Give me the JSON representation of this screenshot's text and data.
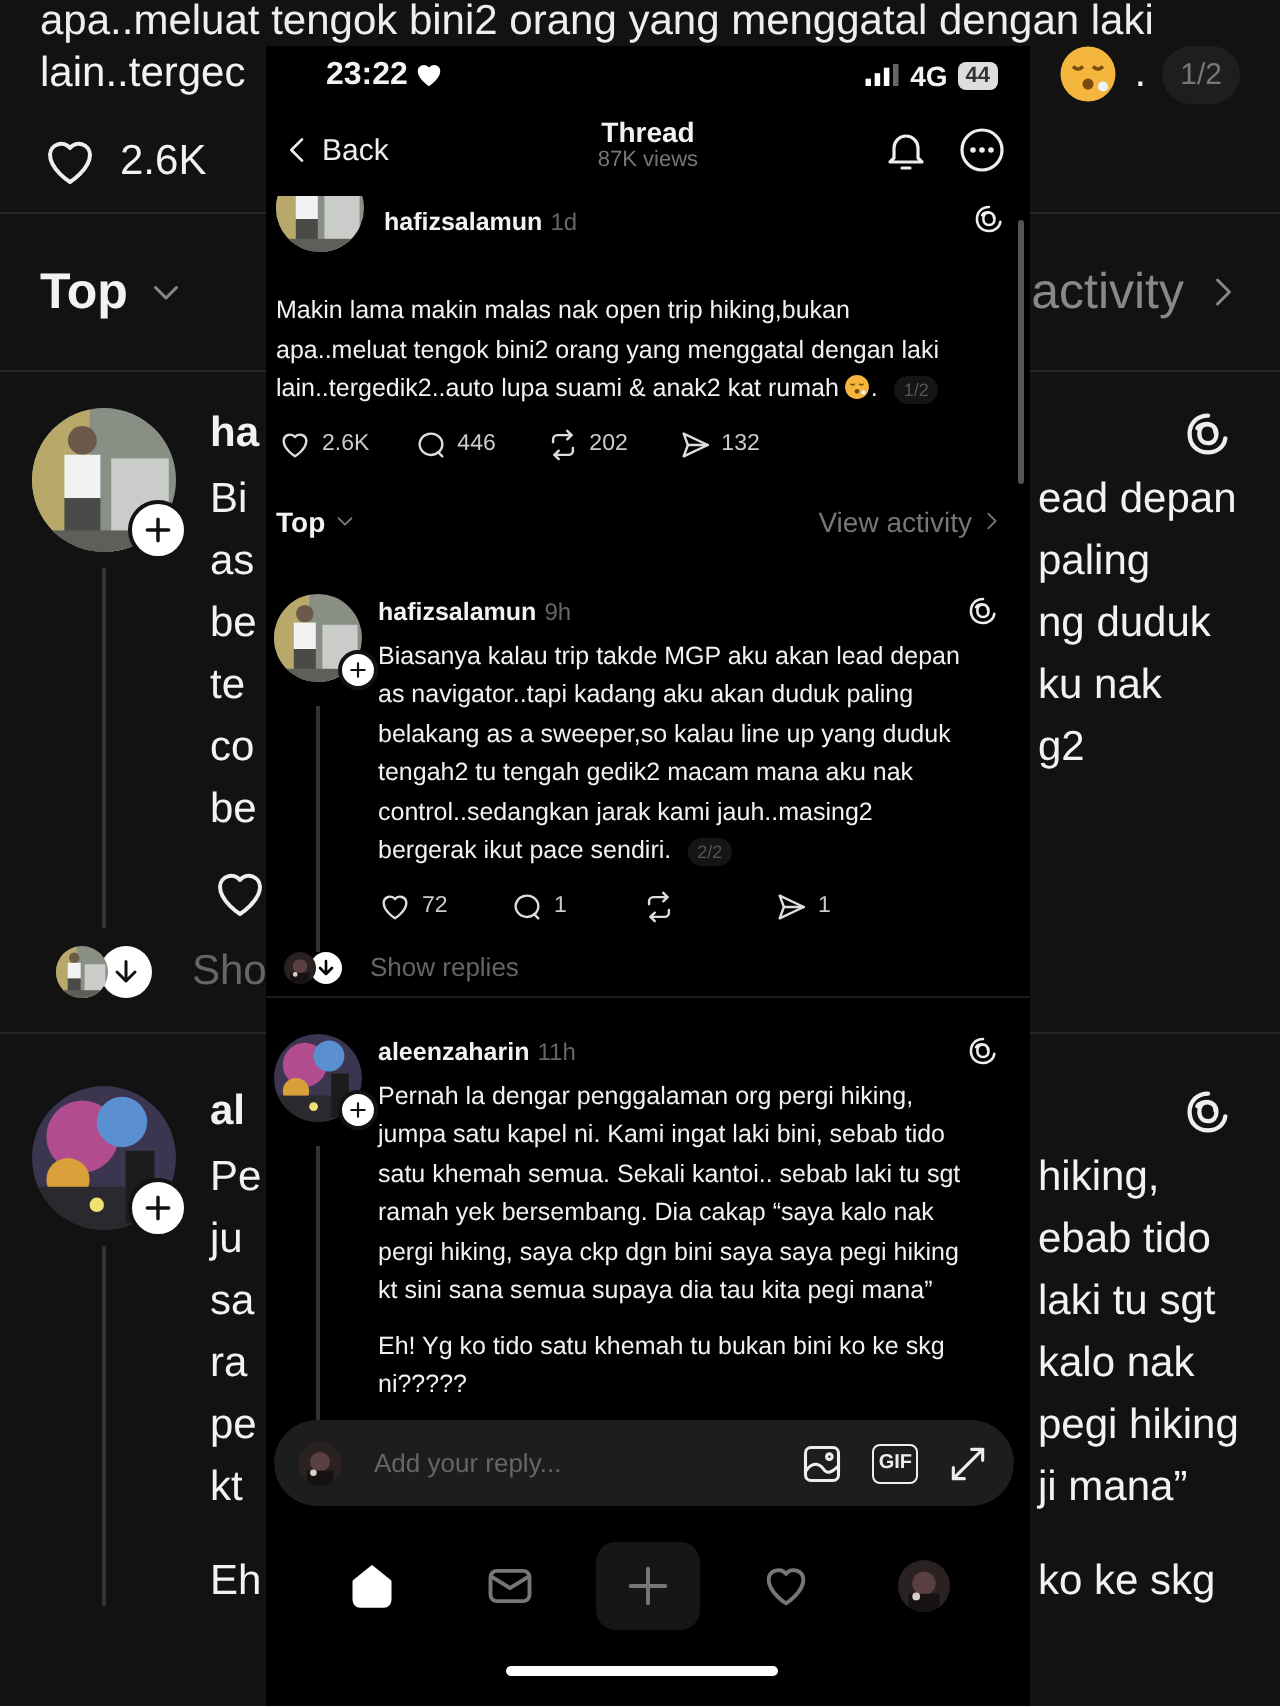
{
  "background": {
    "top_line": "apa..meluat tengok bini2 orang yang menggatal dengan laki",
    "text_left": "lain..tergec",
    "trailing": ".",
    "page_badge": "1/2",
    "likes": "2.6K",
    "sort": "Top",
    "activity": "activity",
    "posts": [
      {
        "username": "ha",
        "left_lines": [
          "Bi",
          "as",
          "be",
          "te",
          "co",
          "be"
        ],
        "right_lines": [
          "ead depan",
          "paling",
          "ng duduk",
          "ku nak",
          "g2"
        ],
        "show_replies": "Sho"
      },
      {
        "username": "al",
        "left_lines": [
          "Pe",
          "ju",
          "sa",
          "ra",
          "pe",
          "kt"
        ],
        "right_lines": [
          "hiking,",
          "ebab tido",
          "laki tu sgt",
          "kalo nak",
          "pegi hiking",
          "ji mana”"
        ],
        "extra_left": "Eh",
        "extra_right": "ko ke skg"
      }
    ]
  },
  "phone": {
    "status_bar": {
      "time": "23:22",
      "network": "4G",
      "battery": "44"
    },
    "nav": {
      "back": "Back",
      "title": "Thread",
      "subtitle": "87K views"
    },
    "post": {
      "username": "hafizsalamun",
      "time": "1d",
      "text": "Makin lama makin malas nak open trip hiking,bukan\napa..meluat tengok bini2 orang yang menggatal dengan laki\nlain..tergedik2..auto lupa suami & anak2 kat rumah",
      "trailing": ".",
      "page_badge": "1/2",
      "actions": [
        {
          "kind": "like",
          "count": "2.6K"
        },
        {
          "kind": "comment",
          "count": "446"
        },
        {
          "kind": "repost",
          "count": "202"
        },
        {
          "kind": "share",
          "count": "132"
        }
      ]
    },
    "sort": {
      "label": "Top",
      "view_activity": "View activity"
    },
    "replies": [
      {
        "username": "hafizsalamun",
        "time": "9h",
        "paragraphs": [
          "Biasanya kalau trip takde MGP aku akan lead depan\nas navigator..tapi kadang aku akan duduk paling\nbelakang as a sweeper,so kalau line up yang duduk\ntengah2 tu tengah gedik2 macam mana aku nak\ncontrol..sedangkan jarak kami jauh..masing2\nbergerak ikut pace sendiri."
        ],
        "page_badge": "2/2",
        "actions": [
          {
            "kind": "like",
            "count": "72"
          },
          {
            "kind": "comment",
            "count": "1"
          },
          {
            "kind": "repost"
          },
          {
            "kind": "share",
            "count": "1"
          }
        ],
        "show_replies": "Show replies"
      },
      {
        "username": "aleenzaharin",
        "time": "11h",
        "paragraphs": [
          "Pernah la dengar penggalaman org pergi hiking,\njumpa satu kapel ni. Kami ingat laki bini, sebab tido\nsatu khemah semua. Sekali kantoi.. sebab laki tu sgt\nramah yek bersembang. Dia cakap “saya kalo nak\npergi hiking, saya ckp dgn bini saya saya pegi hiking\nkt sini sana semua supaya dia tau kita pegi mana”",
          "Eh! Yg ko tido satu khemah tu bukan bini ko ke skg\nni?????"
        ]
      }
    ],
    "composer": {
      "placeholder": "Add your reply...",
      "gif": "GIF"
    },
    "tab_bar": [
      {
        "kind": "home",
        "selected": true
      },
      {
        "kind": "messages",
        "selected": false
      },
      {
        "kind": "create",
        "selected": false
      },
      {
        "kind": "activity",
        "selected": false
      },
      {
        "kind": "profile",
        "selected": false
      }
    ]
  }
}
